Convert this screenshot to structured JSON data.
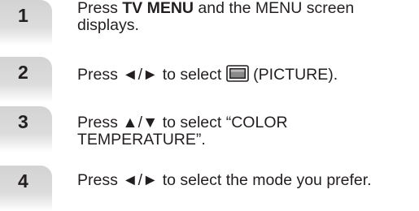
{
  "steps": [
    {
      "number": "1",
      "prefix": "Press ",
      "bold": "TV MENU",
      "suffix": " and the MENU screen displays."
    },
    {
      "number": "2",
      "prefix": "Press ◄/► to select ",
      "icon": "picture-menu-icon",
      "suffix": " (PICTURE)."
    },
    {
      "number": "3",
      "text": "Press ▲/▼ to select “COLOR TEMPERATURE”."
    },
    {
      "number": "4",
      "text": "Press ◄/► to select the mode you prefer."
    }
  ]
}
